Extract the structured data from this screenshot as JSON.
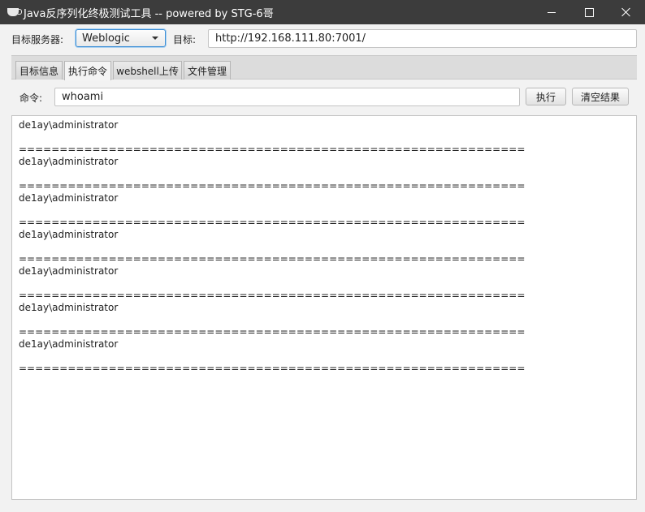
{
  "window": {
    "title": "Java反序列化终极测试工具  -- powered by STG-6哥",
    "icons": [
      "coffee-cup-icon",
      "minimize-icon",
      "maximize-icon",
      "close-icon"
    ]
  },
  "target": {
    "server_label": "目标服务器:",
    "server_selected": "Weblogic",
    "target_label": "目标:",
    "target_url": "http://192.168.111.80:7001/"
  },
  "tabs": [
    {
      "label": "目标信息",
      "active": false
    },
    {
      "label": "执行命令",
      "active": true
    },
    {
      "label": "webshell上传",
      "active": false
    },
    {
      "label": "文件管理",
      "active": false
    }
  ],
  "command": {
    "label": "命令:",
    "value": "whoami",
    "execute_label": "执行",
    "clear_label": "清空结果"
  },
  "output": {
    "lines": [
      "de1ay\\administrator",
      "",
      "==============================================================",
      "de1ay\\administrator",
      "",
      "==============================================================",
      "de1ay\\administrator",
      "",
      "==============================================================",
      "de1ay\\administrator",
      "",
      "==============================================================",
      "de1ay\\administrator",
      "",
      "==============================================================",
      "de1ay\\administrator",
      "",
      "==============================================================",
      "de1ay\\administrator",
      "",
      "=============================================================="
    ]
  }
}
